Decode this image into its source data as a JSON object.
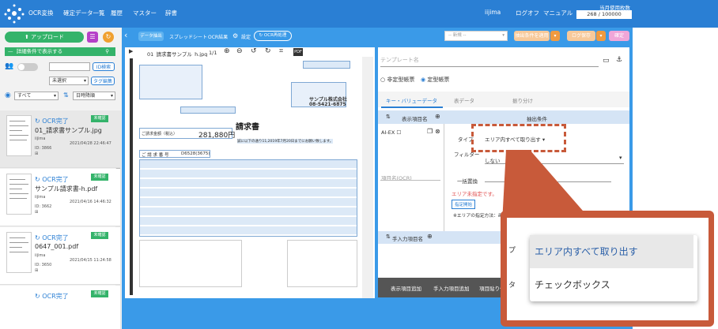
{
  "header": {
    "nav": [
      "OCR変換",
      "確定データ一覧",
      "履歴",
      "マスター",
      "辞書"
    ],
    "user": "iijima",
    "logout": "ログオフ",
    "manual": "マニュアル",
    "usage_title": "当月使用枚数",
    "usage_value": "268 / 100000"
  },
  "sidebar": {
    "upload_label": "アップロード",
    "search_toggle": "詳細条件で表示する",
    "id_search": "ID検索",
    "unselected": "未選択",
    "tag_edit": "タグ編集",
    "filter_all": "すべて",
    "sort": "日時降順",
    "documents": [
      {
        "status": "OCR完了",
        "badge": "未確認",
        "name": "01_請求書サンプル.jpg",
        "user": "iijima",
        "date": "2021/04/28 22:46:47",
        "id": "ID: 3866"
      },
      {
        "status": "OCR完了",
        "badge": "未確認",
        "name": "サンプル請求書-h.pdf",
        "user": "iijima",
        "date": "2021/04/16 14:46:32",
        "id": "ID: 3662"
      },
      {
        "status": "OCR完了",
        "badge": "未確認",
        "name": "0647_001.pdf",
        "user": "iijima",
        "date": "2021/04/15 11:24:58",
        "id": "ID: 3650"
      },
      {
        "status": "OCR完了",
        "badge": "未確認"
      }
    ]
  },
  "toolbar": {
    "tabs": [
      "データ抽出",
      "スプレッドシート",
      "OCR結果"
    ],
    "settings": "設定",
    "reocr": "OCR再処理",
    "select_placeholder": "-- 新規 --",
    "apply_btn": "抽出条件を適用",
    "save_btn": "ログ保存",
    "confirm_btn": "確定"
  },
  "viewer": {
    "filename": "01_請求書サンプル_h.jpg",
    "pages": "1/1"
  },
  "invoice": {
    "title": "請求書",
    "amount_label": "ご請求金額（税込）",
    "amount": "281,880円",
    "message": "誠に以下の通り11,2019年7月20日までにお願い致します。",
    "supplier_name": "サンプル株式会社",
    "phone": "08-5421-6875",
    "section": "ご 請 求 番 号",
    "code": "D6528(3675)"
  },
  "right": {
    "template_placeholder": "テンプレート名",
    "radio_unformatted": "非定型帳票",
    "radio_formatted": "定型帳票",
    "tabs": [
      "キー・バリューデータ",
      "表データ",
      "振り分け"
    ],
    "col_item": "表示項目名",
    "col_cond": "抽出条件",
    "ai_ex": "AI-EX",
    "type_label": "タイプ",
    "type_value": "エリア内すべて取り出す",
    "filter_label": "フィルター",
    "filter_value": "しない",
    "ocr_placeholder": "項目名(OCR)",
    "batch": "一括置換",
    "area_error": "エリア未指定です。",
    "area_btn": "指定開始",
    "note": "※エリアの指定方法：画像上の抽出対象範囲をドラッグ",
    "manual_col": "手入力項目名",
    "bottom_tabs": [
      "表示項目追加",
      "手入力項目追加",
      "項目貼り付け"
    ]
  },
  "popup": {
    "options": [
      "エリア内すべて取り出す",
      "チェックボックス"
    ]
  }
}
